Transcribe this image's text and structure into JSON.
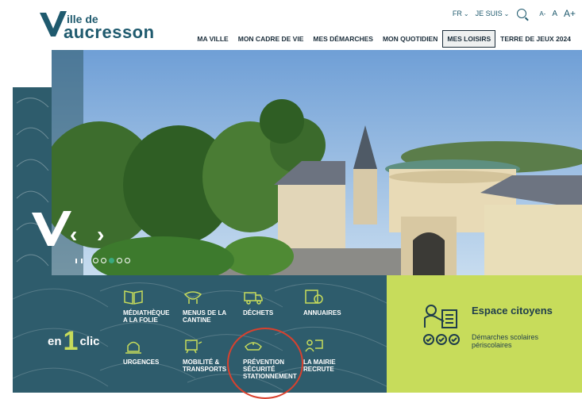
{
  "logo": {
    "line1": "ille de",
    "line2": "aucresson"
  },
  "utility": {
    "lang": "FR",
    "je_suis": "JE SUIS",
    "font_small": "A-",
    "font_medium": "A",
    "font_large": "A+"
  },
  "nav": [
    {
      "label": "MA VILLE"
    },
    {
      "label": "MON CADRE DE VIE"
    },
    {
      "label": "MES DÉMARCHES"
    },
    {
      "label": "MON QUOTIDIEN"
    },
    {
      "label": "MES LOISIRS"
    },
    {
      "label": "TERRE DE JEUX 2024"
    }
  ],
  "slider": {
    "prev": "‹",
    "next": "›",
    "active_slide": 3,
    "slide_count": 5
  },
  "quick": {
    "en": "en",
    "one": "1",
    "clic": "clic",
    "items": [
      {
        "label": "MÉDIATHÈQUE\nA LA FOLIE"
      },
      {
        "label": "MENUS DE LA\nCANTINE"
      },
      {
        "label": "DÉCHETS"
      },
      {
        "label": "ANNUAIRES"
      },
      {
        "label": "URGENCES"
      },
      {
        "label": "MOBILITÉ &\nTRANSPORTS"
      },
      {
        "label": "PRÉVENTION\nSÉCURITÉ\nSTATIONNEMENT"
      },
      {
        "label": "LA MAIRIE\nRECRUTE"
      }
    ]
  },
  "espace": {
    "title": "Espace citoyens",
    "subtitle": "Démarches scolaires périscolaires"
  },
  "colors": {
    "teal": "#2e5c6c",
    "lime": "#c7dc5b",
    "highlight": "#d9412e"
  }
}
